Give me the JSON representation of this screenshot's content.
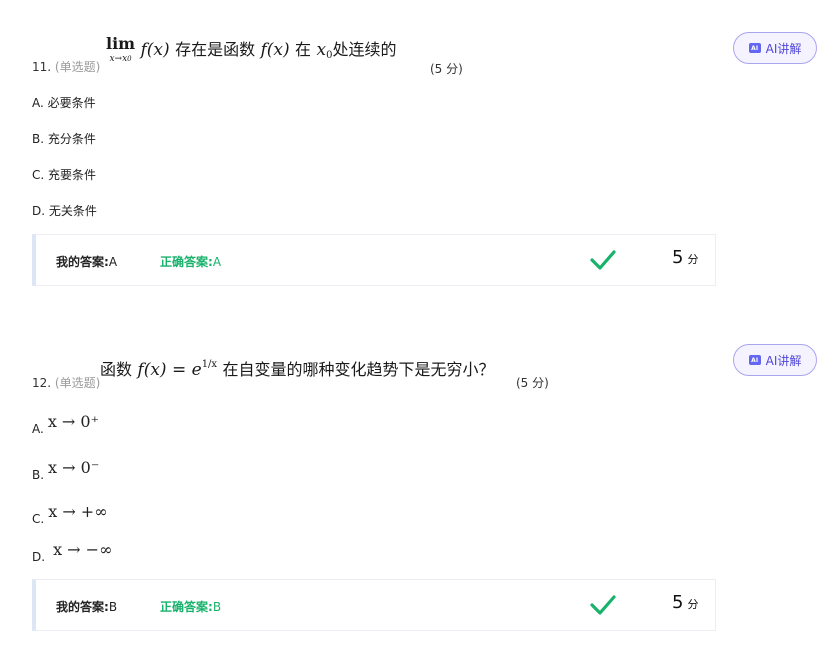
{
  "questions": [
    {
      "number": "11.",
      "type": "(单选题)",
      "stem": {
        "lim_word": "lim",
        "lim_sub": "x→x",
        "lim_sub_idx": "0",
        "fx": "f(x)",
        "text1": "存在是函数",
        "fx2": "f(x)",
        "text2": "在",
        "x0_var": "x",
        "x0_idx": "0",
        "text3": "处连续的"
      },
      "score_tag": "(5 分)",
      "ai_label": "AI讲解",
      "options": [
        {
          "letter": "A.",
          "text": "必要条件"
        },
        {
          "letter": "B.",
          "text": "充分条件"
        },
        {
          "letter": "C.",
          "text": "充要条件"
        },
        {
          "letter": "D.",
          "text": "无关条件"
        }
      ],
      "my_answer_label": "我的答案:",
      "my_answer": "A",
      "correct_label": "正确答案:",
      "correct_answer": "A",
      "score": "5",
      "score_unit": "分"
    },
    {
      "number": "12.",
      "type": "(单选题)",
      "stem": {
        "text1": "函数",
        "fx": "f(x) = e",
        "exp": "1/x",
        "text2": "在自变量的哪种变化趋势下是无穷小？"
      },
      "score_tag": "(5 分)",
      "ai_label": "AI讲解",
      "options": [
        {
          "letter": "A.",
          "math": "x → 0⁺"
        },
        {
          "letter": "B.",
          "math": "x → 0⁻"
        },
        {
          "letter": "C.",
          "math": "x → +∞"
        },
        {
          "letter": "D.",
          "math": "x → −∞"
        }
      ],
      "my_answer_label": "我的答案:",
      "my_answer": "B",
      "correct_label": "正确答案:",
      "correct_answer": "B",
      "score": "5",
      "score_unit": "分"
    }
  ],
  "colors": {
    "correct": "#19b26b",
    "ai_accent": "#4f46d8"
  },
  "icons": {
    "ai": "ai-icon",
    "result": "check-icon"
  }
}
